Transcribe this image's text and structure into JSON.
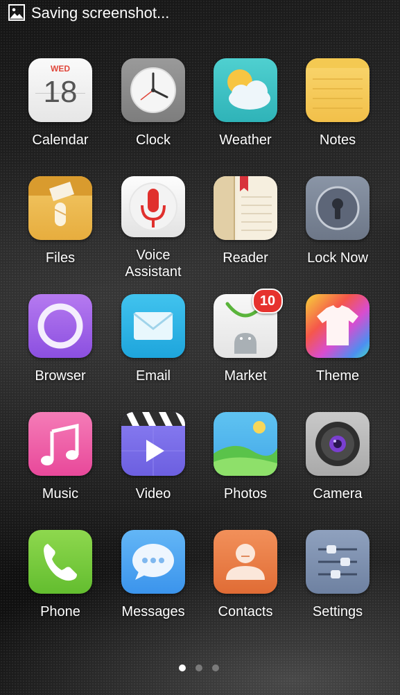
{
  "status_bar": {
    "icon": "image-icon",
    "text": "Saving screenshot..."
  },
  "apps": [
    {
      "label": "Calendar",
      "icon": "calendar-icon",
      "day_name": "WED",
      "day_number": "18"
    },
    {
      "label": "Clock",
      "icon": "clock-icon"
    },
    {
      "label": "Weather",
      "icon": "weather-icon"
    },
    {
      "label": "Notes",
      "icon": "notes-icon"
    },
    {
      "label": "Files",
      "icon": "files-icon"
    },
    {
      "label": "Voice\nAssistant",
      "icon": "microphone-icon"
    },
    {
      "label": "Reader",
      "icon": "book-icon"
    },
    {
      "label": "Lock Now",
      "icon": "lock-icon"
    },
    {
      "label": "Browser",
      "icon": "browser-icon"
    },
    {
      "label": "Email",
      "icon": "envelope-icon"
    },
    {
      "label": "Market",
      "icon": "shopping-bag-icon",
      "badge": "10"
    },
    {
      "label": "Theme",
      "icon": "tshirt-icon"
    },
    {
      "label": "Music",
      "icon": "music-note-icon"
    },
    {
      "label": "Video",
      "icon": "play-icon"
    },
    {
      "label": "Photos",
      "icon": "landscape-icon"
    },
    {
      "label": "Camera",
      "icon": "camera-lens-icon"
    },
    {
      "label": "Phone",
      "icon": "phone-handset-icon"
    },
    {
      "label": "Messages",
      "icon": "chat-bubble-icon"
    },
    {
      "label": "Contacts",
      "icon": "person-icon"
    },
    {
      "label": "Settings",
      "icon": "sliders-icon"
    }
  ],
  "page_indicator": {
    "pages": 3,
    "current": 1
  },
  "colors": {
    "dot_active": "#ffffff",
    "dot_inactive": "#7a7a7a",
    "badge": "#e6322e"
  }
}
